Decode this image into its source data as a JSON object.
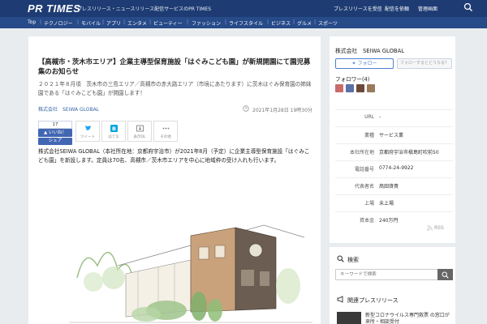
{
  "header": {
    "logo": "PR TIMES",
    "tagline": "プレスリリース・ニュースリリース配信サービスのPR TIMES",
    "buttons": [
      "プレスリリースを受信",
      "配信を依頼",
      "管理画面"
    ]
  },
  "categories": [
    "Top",
    "テクノロジー",
    "モバイル",
    "アプリ",
    "エンタメ",
    "ビューティー",
    "ファッション",
    "ライフスタイル",
    "ビジネス",
    "グルメ",
    "スポーツ"
  ],
  "article": {
    "title": "【高槻市・茨木市エリア】企業主導型保育施設「はぐみこども園」が新規開園にて園児募集のお知らせ",
    "lead": "２０２１年８月頃　茨木市の三島エリア／高槻市の赤大路エリア（市境にあたります）に茨木はぐみ保育園の姉妹園である「はぐみこども園」が開園します！",
    "company": "株式会社　SEIWA GLOBAL",
    "date": "2021年1月28日 19時30分",
    "like_count": "17",
    "like_label": "いいね！",
    "share_label": "シェア",
    "share_buttons": [
      "ツイート",
      "はてな",
      "表示DL",
      "その他"
    ],
    "body": "株式会社SEIWA GLOBAL（本社所在地：京都府宇治市）が2021年8月（予定）に企業主導型保育施設「はぐみこども園」を新設します。定員は70名、高槻市／茨木市エリアを中心に地域枠の受け入れも行います。"
  },
  "sidebar": {
    "company_name": "株式会社　SEIWA GLOBAL",
    "follow_label": "フォロー",
    "follow_help": "フォローするとどうなる？",
    "followers_label": "フォロワー(4)",
    "avatar_colors": [
      "#c86a6a",
      "#5b6fa8",
      "#6c4a3a",
      "#9a7a5a"
    ],
    "info": [
      {
        "key": "URL",
        "value": "-"
      },
      {
        "key": "業種",
        "value": "サービス業"
      },
      {
        "key": "本社所在地",
        "value": "京都府宇治市槇島町吹前50"
      },
      {
        "key": "電話番号",
        "value": "0774-24-9922"
      },
      {
        "key": "代表者名",
        "value": "髙田啓貴"
      },
      {
        "key": "上場",
        "value": "未上場"
      },
      {
        "key": "資本金",
        "value": "240万円"
      }
    ],
    "rss": "RSS"
  },
  "search": {
    "title": "検索",
    "placeholder": "キーワードで検索"
  },
  "related": {
    "title": "関連プレスリリース",
    "item_text": "新型コロナウイルス専門救票 の窓口が来所・相談受付"
  }
}
